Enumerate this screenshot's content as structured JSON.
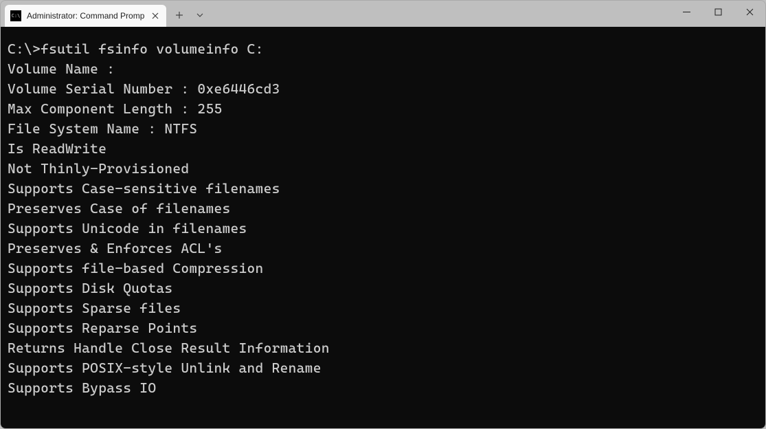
{
  "tab": {
    "title": "Administrator: Command Promp"
  },
  "terminal": {
    "prompt": "C:\\>",
    "command": "fsutil fsinfo volumeinfo C:",
    "output": [
      "Volume Name :",
      "Volume Serial Number : 0xe6446cd3",
      "Max Component Length : 255",
      "File System Name : NTFS",
      "Is ReadWrite",
      "Not Thinly-Provisioned",
      "Supports Case-sensitive filenames",
      "Preserves Case of filenames",
      "Supports Unicode in filenames",
      "Preserves & Enforces ACL's",
      "Supports file-based Compression",
      "Supports Disk Quotas",
      "Supports Sparse files",
      "Supports Reparse Points",
      "Returns Handle Close Result Information",
      "Supports POSIX-style Unlink and Rename",
      "Supports Bypass IO"
    ]
  }
}
